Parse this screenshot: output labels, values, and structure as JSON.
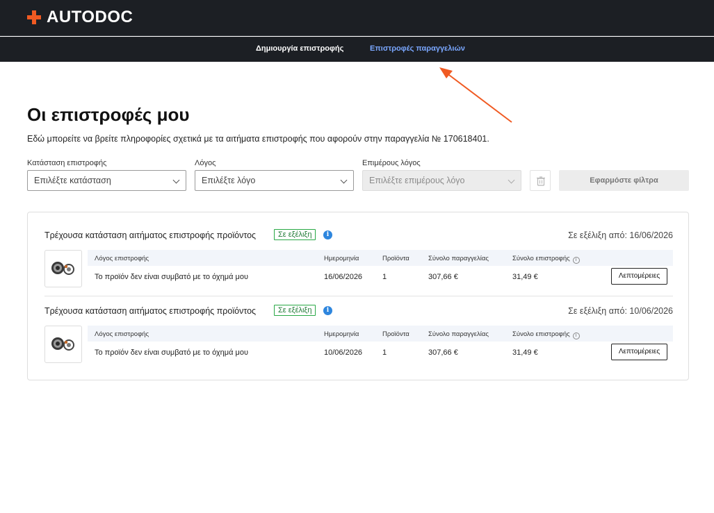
{
  "header": {
    "logo_text": "AUTODOC",
    "nav": {
      "create_return": "Δημιουργία επιστροφής",
      "order_returns": "Επιστροφές παραγγελιών"
    }
  },
  "page": {
    "title": "Οι επιστροφές μου",
    "description": "Εδώ μπορείτε να βρείτε πληροφορίες σχετικά με τα αιτήματα επιστροφής που αφορούν στην παραγγελία № 170618401."
  },
  "filters": {
    "status": {
      "label": "Κατάσταση επιστροφής",
      "placeholder": "Επιλέξτε κατάσταση"
    },
    "reason": {
      "label": "Λόγος",
      "placeholder": "Επιλέξτε λόγο"
    },
    "sub_reason": {
      "label": "Επιμέρους λόγος",
      "placeholder": "Επιλέξτε επιμέρους λόγο"
    },
    "apply_label": "Εφαρμόστε φίλτρα"
  },
  "columns": {
    "reason": "Λόγος επιστροφής",
    "date": "Ημερομηνία",
    "products": "Προϊόντα",
    "order_total": "Σύνολο παραγγελίας",
    "return_total": "Σύνολο επιστροφής"
  },
  "returns": [
    {
      "status_title": "Τρέχουσα κατάσταση αιτήματος επιστροφής προϊόντος",
      "badge": "Σε εξέλιξη",
      "since": "Σε εξέλιξη από: 16/06/2026",
      "reason": "Το προϊόν δεν είναι συμβατό με το όχημά μου",
      "date": "16/06/2026",
      "products": "1",
      "order_total": "307,66 €",
      "return_total": "31,49 €",
      "details_label": "Λεπτομέρειες"
    },
    {
      "status_title": "Τρέχουσα κατάσταση αιτήματος επιστροφής προϊόντος",
      "badge": "Σε εξέλιξη",
      "since": "Σε εξέλιξη από: 10/06/2026",
      "reason": "Το προϊόν δεν είναι συμβατό με το όχημά μου",
      "date": "10/06/2026",
      "products": "1",
      "order_total": "307,66 €",
      "return_total": "31,49 €",
      "details_label": "Λεπτομέρειες"
    }
  ],
  "colors": {
    "header_bg": "#1c1f24",
    "brand_orange": "#f05a22",
    "active_link": "#7aa7ff",
    "status_green": "#27a844",
    "info_blue": "#2e86de"
  }
}
